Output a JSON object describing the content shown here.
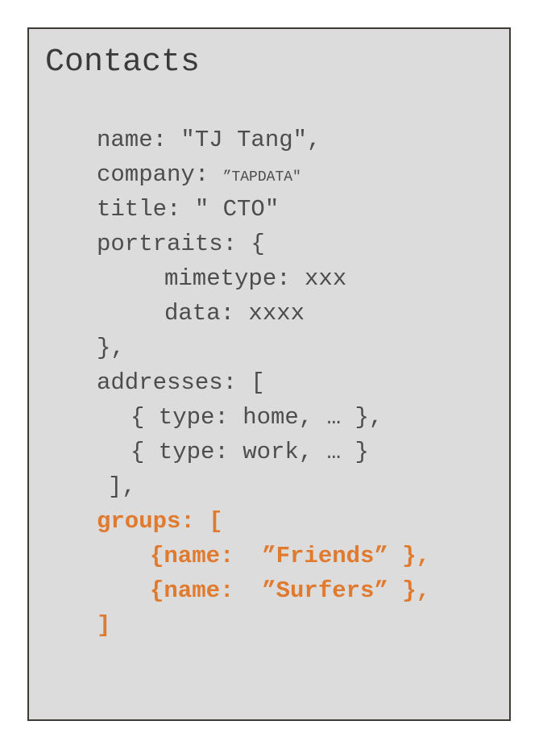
{
  "title": "Contacts",
  "colors": {
    "background": "#dcdcdc",
    "border": "#3e3a36",
    "text": "#4d4d4d",
    "highlight": "#e07a2e"
  },
  "lines": {
    "name": "name: \"TJ Tang\",",
    "company_key": "company: ",
    "company_value": "”TAPDATA\"",
    "title_line": "title: \" CTO\"",
    "portraits_open": "portraits: {",
    "mimetype": "mimetype: xxx",
    "data": "data: xxxx",
    "portraits_close": "},",
    "addresses_open": "addresses: [",
    "address_home": "{ type: home, … },",
    "address_work": "{ type: work, … }",
    "addresses_close": "],",
    "groups_open": "groups: [",
    "group_friends": "{name:  ”Friends” },",
    "group_surfers": "{name:  ”Surfers” },",
    "groups_close": "]"
  }
}
